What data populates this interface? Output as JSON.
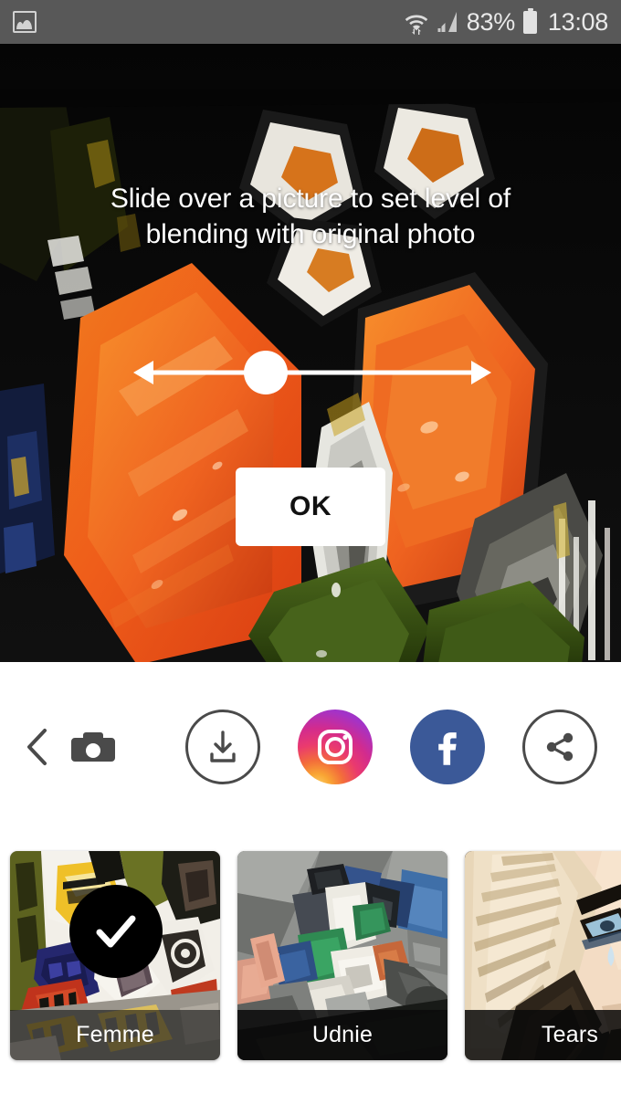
{
  "status_bar": {
    "notification_icon": "gallery-icon",
    "wifi_icon": "wifi-icon",
    "signal_icon": "signal-bars-icon",
    "battery_percent": "83%",
    "battery_icon": "battery-icon",
    "time": "13:08",
    "background_color": "#585858",
    "text_color": "#e9e9e9"
  },
  "stage": {
    "hint_text": "Slide over a picture to set level of blending with original photo",
    "photo_description": "salmon-sushi-stylized-photo",
    "slider": {
      "name": "blend-level-slider",
      "left_arrow": "arrow-left-icon",
      "right_arrow": "arrow-right-icon",
      "knob_position_percent": 32
    },
    "ok_button": "OK"
  },
  "action_bar": {
    "back_label": "back-chevron",
    "camera_label": "camera",
    "download_label": "download",
    "instagram_label": "instagram",
    "facebook_label": "facebook",
    "share_label": "share",
    "instagram_gradient": "#8a3ab9",
    "facebook_color": "#3b5998",
    "icon_color": "#4a4a4a"
  },
  "styles": {
    "items": [
      {
        "label": "Femme",
        "selected": true,
        "check_icon": "check-icon"
      },
      {
        "label": "Udnie",
        "selected": false,
        "check_icon": "check-icon"
      },
      {
        "label": "Tears",
        "selected": false,
        "check_icon": "check-icon"
      }
    ]
  }
}
